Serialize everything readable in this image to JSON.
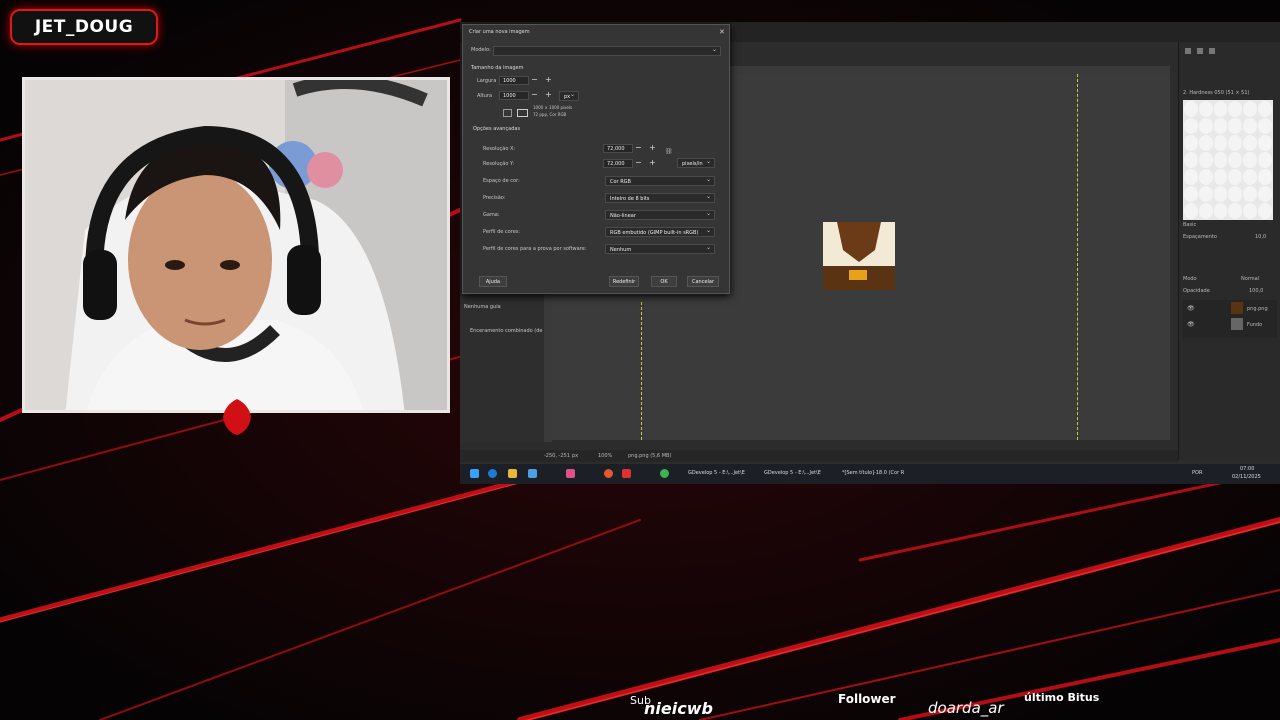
{
  "streamer": {
    "name": "JET_DOUG"
  },
  "colors": {
    "accent": "#e01818",
    "gimp_bg": "#2c2c2c",
    "dialog_bg": "#353535"
  },
  "dialog": {
    "title": "Criar uma nova imagem",
    "template_label": "Modelo:",
    "image_size_header": "Tamanho da imagem",
    "width_label": "Largura",
    "width_value": "1000",
    "height_label": "Altura",
    "height_value": "1000",
    "unit": "px",
    "size_info": "1000 × 1000 pixels",
    "dpi_info": "72 ppp, Cor RGB",
    "advanced_header": "Opções avançadas",
    "res_x_label": "Resolução X:",
    "res_x_value": "72,000",
    "res_y_label": "Resolução Y:",
    "res_y_value": "72,000",
    "res_unit": "pixels/in",
    "color_space_label": "Espaço de cor:",
    "color_space_value": "Cor RGB",
    "precision_label": "Precisão:",
    "precision_value": "Inteiro de 8 bits",
    "gamma_label": "Gama:",
    "gamma_value": "Não-linear",
    "profile_label": "Perfil de cores:",
    "profile_value": "RGB embutido (GIMP built-in sRGB)",
    "softproof_label": "Perfil de cores para a prova por software:",
    "softproof_value": "Nenhum",
    "help_btn": "Ajuda",
    "reset_btn": "Redefinir",
    "ok_btn": "OK",
    "cancel_btn": "Cancelar"
  },
  "left_panel": {
    "item1": "Nenhuma guia",
    "item2": "Enceramento combinado (de"
  },
  "right_dock": {
    "brushes_title": "2. Hardness 050 (51 × 51)",
    "preset": "Basic",
    "spacing_label": "Espaçamento",
    "spacing_value": "10,0",
    "mode_label": "Modo",
    "mode_value": "Normal",
    "opacity_label": "Opacidade",
    "opacity_value": "100,0",
    "layer1": "png.png",
    "layer2": "Fundo"
  },
  "status": {
    "coords": "-250, -251",
    "unit": "px",
    "zoom": "100%",
    "file": "png.png (5,6 MB)"
  },
  "taskbar": {
    "app1": "GDevelop 5 - E:\\...Jet\\E",
    "app2": "GDevelop 5 - E:\\...Jet\\E",
    "app3": "*[Sem título]-18.0 (Cor R",
    "lang": "POR",
    "time": "07:00",
    "date": "02/11/2025"
  },
  "overlay": {
    "sub_label": "Sub",
    "sub_name": "nieicwb",
    "follower_label": "Follower",
    "follower_name": "doarda_ar",
    "bits_label": "último Bitus"
  }
}
